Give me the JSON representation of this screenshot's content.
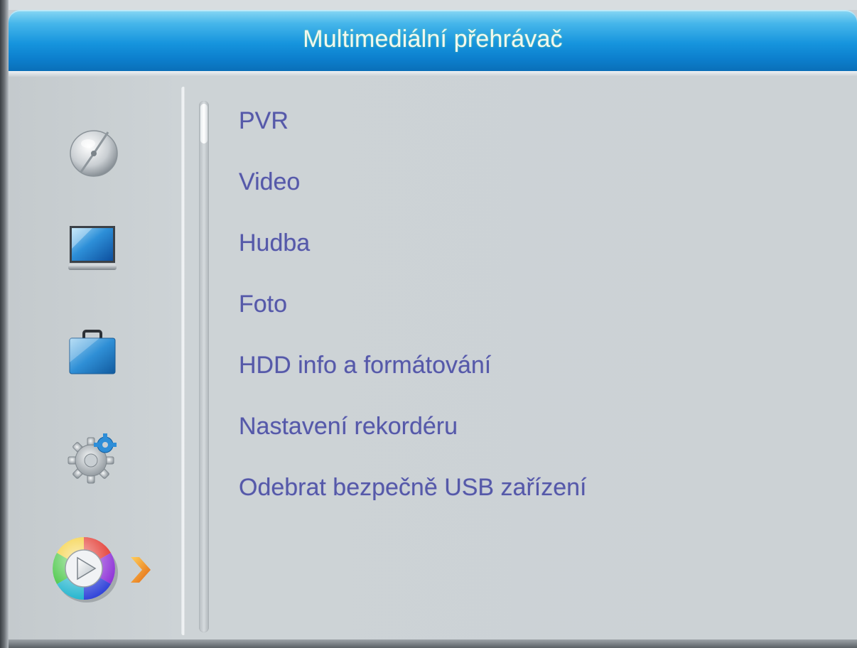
{
  "header": {
    "title": "Multimediální přehrávač"
  },
  "sidebar": {
    "categories": [
      {
        "name": "satellite-dish-icon",
        "active": false
      },
      {
        "name": "tv-monitor-icon",
        "active": false
      },
      {
        "name": "briefcase-icon",
        "active": false
      },
      {
        "name": "gear-icon",
        "active": false
      },
      {
        "name": "multimedia-play-icon",
        "active": true
      }
    ],
    "selected_indicator": "chevron-right-icon"
  },
  "menu": {
    "items": [
      {
        "label": "PVR"
      },
      {
        "label": "Video"
      },
      {
        "label": "Hudba"
      },
      {
        "label": "Foto"
      },
      {
        "label": "HDD info a formátování"
      },
      {
        "label": "Nastavení rekordéru"
      },
      {
        "label": "Odebrat bezpečně USB zařízení"
      }
    ]
  },
  "colors": {
    "title_bar": "#1694dd",
    "menu_text": "#5559a8",
    "background": "#c9cfd3",
    "selection_arrow": "#f07a16"
  }
}
